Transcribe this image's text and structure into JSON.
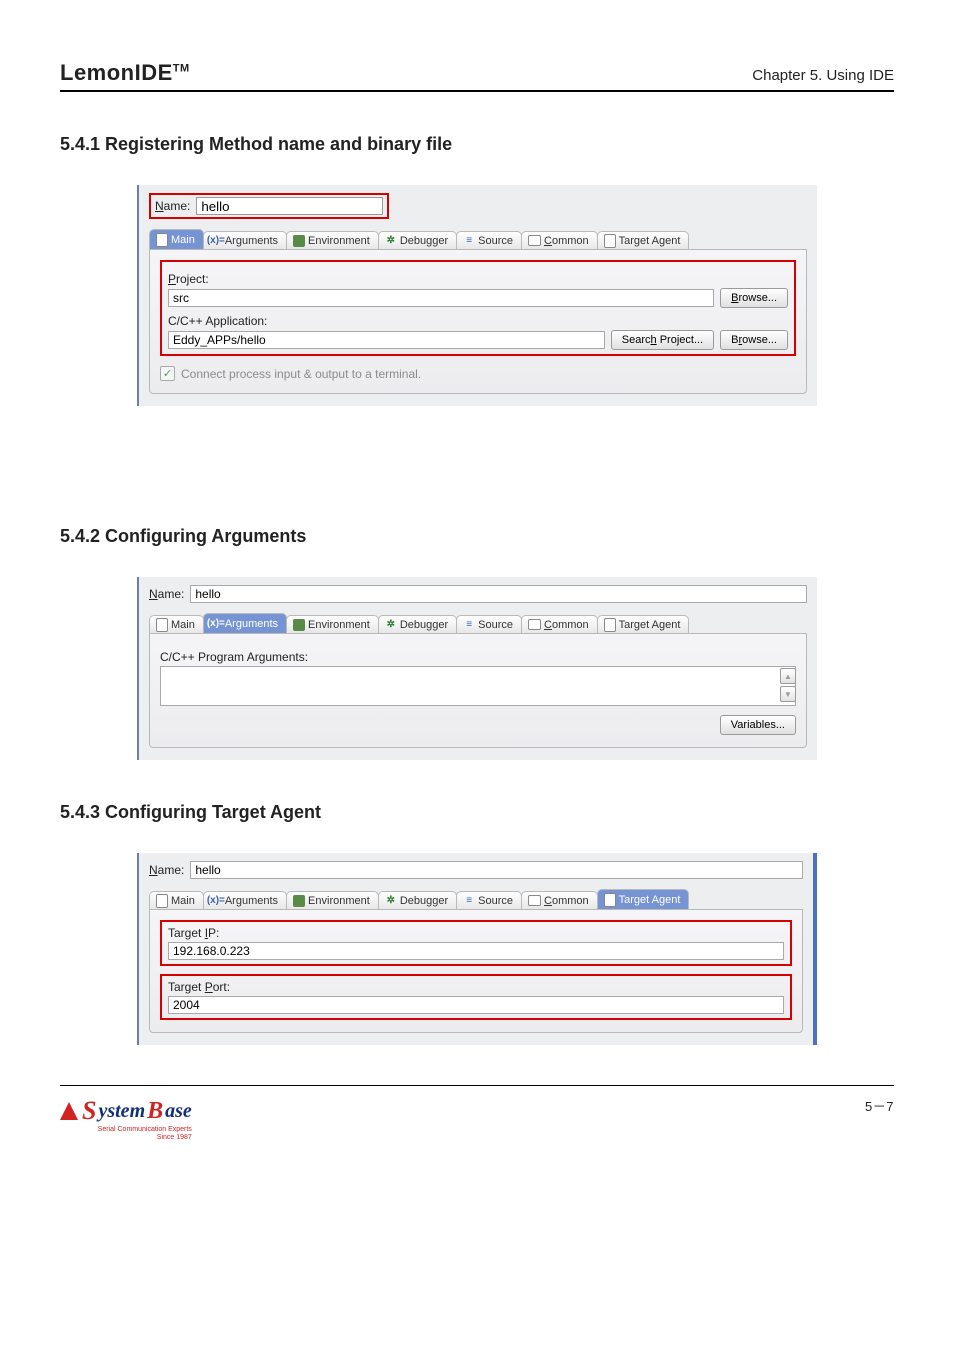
{
  "header": {
    "product": "LemonIDE",
    "trademark": "TM",
    "chapter": "Chapter 5. Using IDE"
  },
  "sections": {
    "s1": {
      "heading": "5.4.1 Registering Method name and binary file"
    },
    "s2": {
      "heading": "5.4.2 Configuring Arguments"
    },
    "s3": {
      "heading": "5.4.3 Configuring Target Agent"
    }
  },
  "common": {
    "name_label_pre": "N",
    "name_label_post": "ame:",
    "name_value": "hello"
  },
  "tabs": {
    "main": "Main",
    "arguments": "Arguments",
    "arguments_prefix": "(x)=",
    "environment": "Environment",
    "debugger": "Debugger",
    "source": "Source",
    "common_pre": "C",
    "common_post": "ommon",
    "target_agent": "Target Agent"
  },
  "panel1": {
    "project_label_pre": "P",
    "project_label_post": "roject:",
    "project_value": "src",
    "app_label": "C/C++ Application:",
    "app_value": "Eddy_APPs/hello",
    "browse_pre": "B",
    "browse_post": "rowse...",
    "search_pre": "Searc",
    "search_u": "h",
    "search_post": " Project...",
    "browse2_pre": "B",
    "browse2_u": "r",
    "browse2_post": "owse...",
    "checkbox_label": "Connect process input & output to a terminal."
  },
  "panel2": {
    "args_label": "C/C++ Program Arguments:",
    "args_value": "",
    "variables_btn": "Variables..."
  },
  "panel3": {
    "ip_label_pre": "Target ",
    "ip_u": "I",
    "ip_label_post": "P:",
    "ip_value": "192.168.0.223",
    "port_label_pre": "Target ",
    "port_u": "P",
    "port_label_post": "ort:",
    "port_value": "2004"
  },
  "footer": {
    "page_number": "5－7",
    "logo_text_1": "S",
    "logo_text_2": "ystem",
    "logo_text_3": "B",
    "logo_text_4": "ase",
    "tagline1": "Serial Communication Experts",
    "tagline2": "Since 1987"
  }
}
